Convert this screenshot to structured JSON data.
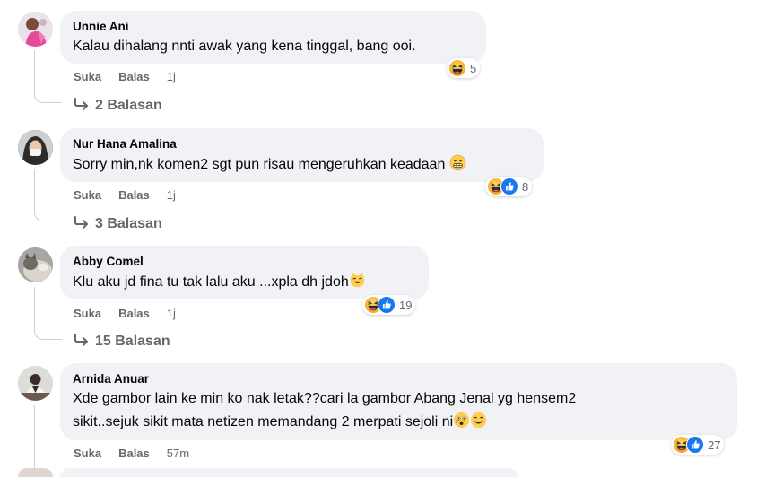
{
  "comments": [
    {
      "author": "Unnie Ani",
      "text": "Kalau dihalang nnti awak yang kena tinggal, bang ooi.",
      "reaction_count": "5",
      "reactions": [
        "haha"
      ],
      "like_label": "Suka",
      "reply_label": "Balas",
      "time": "1j",
      "replies_label": "2 Balasan"
    },
    {
      "author": "Nur Hana Amalina",
      "text": "Sorry min,nk komen2 sgt pun risau mengeruhkan keadaan",
      "text_emoji": "grimace",
      "reaction_count": "8",
      "reactions": [
        "haha",
        "like"
      ],
      "like_label": "Suka",
      "reply_label": "Balas",
      "time": "1j",
      "replies_label": "3 Balasan"
    },
    {
      "author": "Abby Comel",
      "text": "Klu aku jd fina tu tak lalu aku ...xpla dh jdoh",
      "text_emoji": "cat",
      "reaction_count": "19",
      "reactions": [
        "haha",
        "like"
      ],
      "like_label": "Suka",
      "reply_label": "Balas",
      "time": "1j",
      "replies_label": "15 Balasan"
    },
    {
      "author": "Arnida Anuar",
      "text_line1": "Xde gambor lain ke min ko nak letak??cari la gambor Abang Jenal yg hensem2",
      "text_line2": "sikit..sejuk sikit mata netizen memandang 2 merpati sejoli ni",
      "reaction_count": "27",
      "reactions": [
        "haha",
        "like"
      ],
      "like_label": "Suka",
      "reply_label": "Balas",
      "time": "57m"
    }
  ],
  "colors": {
    "bubble": "#f0f2f5",
    "secondary_text": "#65676b",
    "like_blue": "#1877f2",
    "haha_yellow": "#f7b125"
  }
}
